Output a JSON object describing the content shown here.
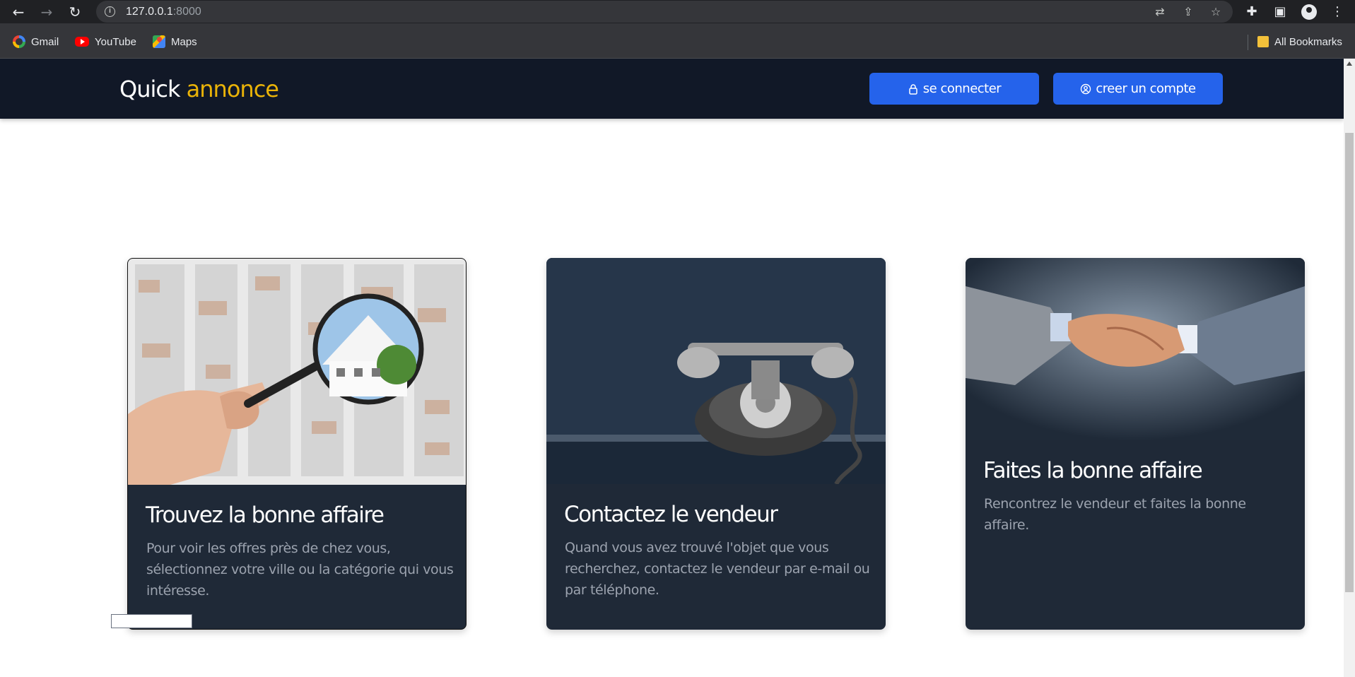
{
  "browser": {
    "url_host": "127.0.0.1",
    "url_port": ":8000",
    "bookmarks": [
      "Gmail",
      "YouTube",
      "Maps"
    ],
    "all_bookmarks": "All Bookmarks"
  },
  "header": {
    "brand_main": "Quick ",
    "brand_accent": "annonce",
    "login_label": "se connecter",
    "signup_label": "creer un compte"
  },
  "cards": [
    {
      "title": "Trouvez la bonne affaire",
      "text": "Pour voir les offres près de chez vous, sélectionnez votre ville ou la catégorie qui vous intéresse."
    },
    {
      "title": "Contactez le vendeur",
      "text": "Quand vous avez trouvé l'objet que vous recherchez, contactez le vendeur par e-mail ou par téléphone."
    },
    {
      "title": "Faites la bonne affaire",
      "text": "Rencontrez le vendeur et faites la bonne affaire."
    }
  ],
  "colors": {
    "navbar": "#111827",
    "accent": "#eab308",
    "button": "#2563eb",
    "card": "#1f2937"
  }
}
